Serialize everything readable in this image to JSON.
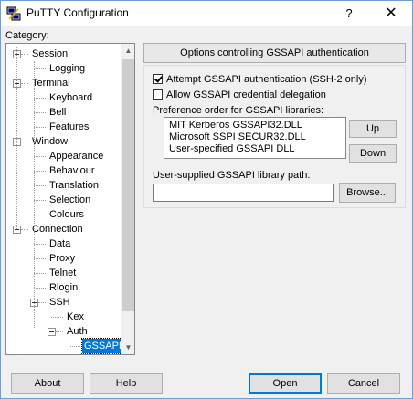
{
  "window": {
    "title": "PuTTY Configuration",
    "help_button": "?",
    "close_button": "✕"
  },
  "sidebar": {
    "category_label": "Category:",
    "tree": [
      {
        "label": "Session",
        "level": 0,
        "expander": true
      },
      {
        "label": "Logging",
        "level": 1
      },
      {
        "label": "Terminal",
        "level": 0,
        "expander": true
      },
      {
        "label": "Keyboard",
        "level": 1
      },
      {
        "label": "Bell",
        "level": 1
      },
      {
        "label": "Features",
        "level": 1
      },
      {
        "label": "Window",
        "level": 0,
        "expander": true
      },
      {
        "label": "Appearance",
        "level": 1
      },
      {
        "label": "Behaviour",
        "level": 1
      },
      {
        "label": "Translation",
        "level": 1
      },
      {
        "label": "Selection",
        "level": 1
      },
      {
        "label": "Colours",
        "level": 1
      },
      {
        "label": "Connection",
        "level": 0,
        "expander": true
      },
      {
        "label": "Data",
        "level": 1
      },
      {
        "label": "Proxy",
        "level": 1
      },
      {
        "label": "Telnet",
        "level": 1
      },
      {
        "label": "Rlogin",
        "level": 1
      },
      {
        "label": "SSH",
        "level": 1,
        "expander": true
      },
      {
        "label": "Kex",
        "level": 2
      },
      {
        "label": "Auth",
        "level": 2,
        "expander": true
      },
      {
        "label": "GSSAPI",
        "level": 3,
        "selected": true
      }
    ]
  },
  "panel": {
    "header": "Options controlling GSSAPI authentication",
    "attempt_gssapi": {
      "label": "Attempt GSSAPI authentication (SSH-2 only)",
      "checked": true
    },
    "allow_delegation": {
      "label": "Allow GSSAPI credential delegation",
      "checked": false
    },
    "preference_label": "Preference order for GSSAPI libraries:",
    "libraries": [
      "MIT Kerberos GSSAPI32.DLL",
      "Microsoft SSPI SECUR32.DLL",
      "User-specified GSSAPI DLL"
    ],
    "up_button": "Up",
    "down_button": "Down",
    "path_label": "User-supplied GSSAPI library path:",
    "path_value": "",
    "browse_button": "Browse..."
  },
  "footer": {
    "about_button": "About",
    "help_button": "Help",
    "open_button": "Open",
    "cancel_button": "Cancel"
  },
  "colors": {
    "selection": "#0078d7",
    "window_border": "#6d9ed9",
    "background": "#f0f0f0"
  }
}
